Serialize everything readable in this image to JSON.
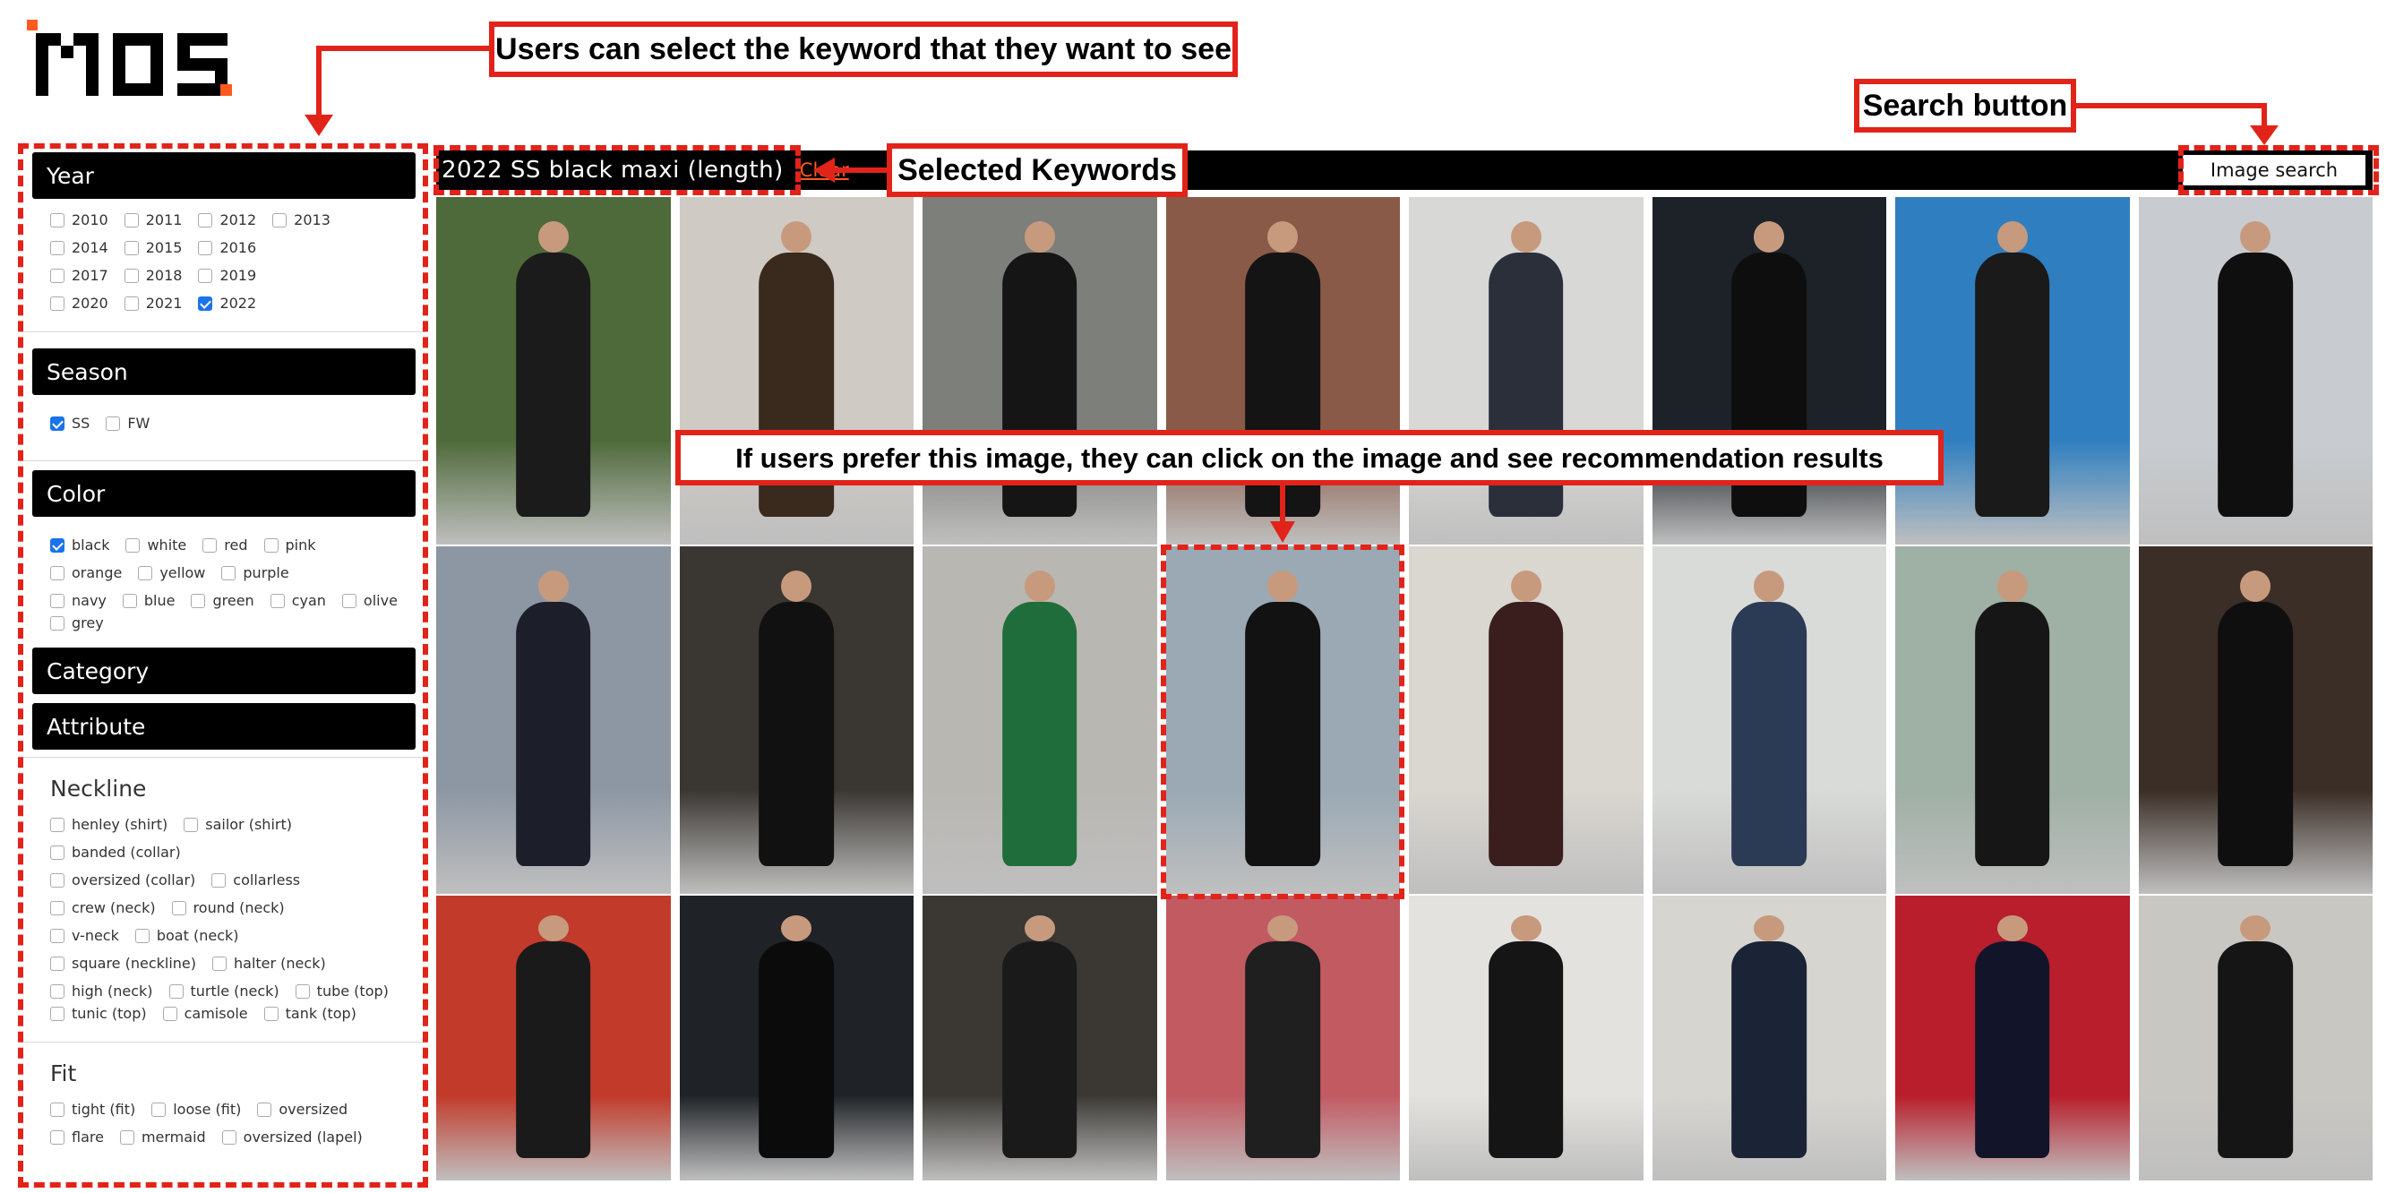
{
  "logo": {
    "text": "MOS",
    "accent": "#ff5a1f"
  },
  "annotations": {
    "keyword": "Users can select the keyword that they want to see",
    "search": "Search button",
    "selected": "Selected Keywords",
    "prefer": "If users prefer this image, they can click on the image and see recommendation results"
  },
  "topbar": {
    "keywords": "2022  SS  black  maxi (length)",
    "clear": "Clear",
    "image_search": "Image search"
  },
  "sidebar": {
    "year": {
      "title": "Year",
      "options": [
        {
          "label": "2010",
          "checked": false
        },
        {
          "label": "2011",
          "checked": false
        },
        {
          "label": "2012",
          "checked": false
        },
        {
          "label": "2013",
          "checked": false
        },
        {
          "label": "2014",
          "checked": false
        },
        {
          "label": "2015",
          "checked": false
        },
        {
          "label": "2016",
          "checked": false
        },
        {
          "label": "2017",
          "checked": false
        },
        {
          "label": "2018",
          "checked": false
        },
        {
          "label": "2019",
          "checked": false
        },
        {
          "label": "2020",
          "checked": false
        },
        {
          "label": "2021",
          "checked": false
        },
        {
          "label": "2022",
          "checked": true
        }
      ]
    },
    "season": {
      "title": "Season",
      "options": [
        {
          "label": "SS",
          "checked": true
        },
        {
          "label": "FW",
          "checked": false
        }
      ]
    },
    "color": {
      "title": "Color",
      "options": [
        {
          "label": "black",
          "checked": true
        },
        {
          "label": "white",
          "checked": false
        },
        {
          "label": "red",
          "checked": false
        },
        {
          "label": "pink",
          "checked": false
        },
        {
          "label": "orange",
          "checked": false
        },
        {
          "label": "yellow",
          "checked": false
        },
        {
          "label": "purple",
          "checked": false
        },
        {
          "label": "navy",
          "checked": false
        },
        {
          "label": "blue",
          "checked": false
        },
        {
          "label": "green",
          "checked": false
        },
        {
          "label": "cyan",
          "checked": false
        },
        {
          "label": "olive",
          "checked": false
        },
        {
          "label": "grey",
          "checked": false
        }
      ]
    },
    "category": {
      "title": "Category"
    },
    "attribute": {
      "title": "Attribute"
    },
    "neckline": {
      "title": "Neckline",
      "options": [
        {
          "label": "henley (shirt)",
          "checked": false
        },
        {
          "label": "sailor (shirt)",
          "checked": false
        },
        {
          "label": "banded (collar)",
          "checked": false
        },
        {
          "label": "oversized (collar)",
          "checked": false
        },
        {
          "label": "collarless",
          "checked": false
        },
        {
          "label": "crew (neck)",
          "checked": false
        },
        {
          "label": "round (neck)",
          "checked": false
        },
        {
          "label": "v-neck",
          "checked": false
        },
        {
          "label": "boat (neck)",
          "checked": false
        },
        {
          "label": "square (neckline)",
          "checked": false
        },
        {
          "label": "halter (neck)",
          "checked": false
        },
        {
          "label": "high (neck)",
          "checked": false
        },
        {
          "label": "turtle (neck)",
          "checked": false
        },
        {
          "label": "tube (top)",
          "checked": false
        },
        {
          "label": "tunic (top)",
          "checked": false
        },
        {
          "label": "camisole",
          "checked": false
        },
        {
          "label": "tank (top)",
          "checked": false
        }
      ]
    },
    "fit": {
      "title": "Fit",
      "options": [
        {
          "label": "tight (fit)",
          "checked": false
        },
        {
          "label": "loose (fit)",
          "checked": false
        },
        {
          "label": "oversized",
          "checked": false
        },
        {
          "label": "flare",
          "checked": false
        },
        {
          "label": "mermaid",
          "checked": false
        },
        {
          "label": "oversized (lapel)",
          "checked": false
        }
      ]
    }
  },
  "photos": [
    {
      "bg": "#4f6a3a",
      "fig": "#1b1b1b"
    },
    {
      "bg": "#cfcac3",
      "fig": "#3a2a1e"
    },
    {
      "bg": "#7d7f7a",
      "fig": "#151515"
    },
    {
      "bg": "#8a5a48",
      "fig": "#141414"
    },
    {
      "bg": "#d8d8d6",
      "fig": "#2a2f3a"
    },
    {
      "bg": "#1c2228",
      "fig": "#0e0e0e"
    },
    {
      "bg": "#2f7fc0",
      "fig": "#1a1a1a"
    },
    {
      "bg": "#c8ccd0",
      "fig": "#0f0f0f"
    },
    {
      "bg": "#8d97a3",
      "fig": "#1c1f2a"
    },
    {
      "bg": "#3a3632",
      "fig": "#111111"
    },
    {
      "bg": "#b9b7b2",
      "fig": "#1f6d3a"
    },
    {
      "bg": "#9aa9b4",
      "fig": "#121212"
    },
    {
      "bg": "#dad6d0",
      "fig": "#3a1e1e"
    },
    {
      "bg": "#d9dbd8",
      "fig": "#2b3a55"
    },
    {
      "bg": "#9fb0a5",
      "fig": "#161616"
    },
    {
      "bg": "#3a2e26",
      "fig": "#0f0f0f"
    },
    {
      "bg": "#c23a2a",
      "fig": "#1a1a1a"
    },
    {
      "bg": "#1f2226",
      "fig": "#0b0b0b"
    },
    {
      "bg": "#3b3834",
      "fig": "#1a1a1a"
    },
    {
      "bg": "#c25a62",
      "fig": "#1f1f1f"
    },
    {
      "bg": "#e3e2de",
      "fig": "#151515"
    },
    {
      "bg": "#d6d5d0",
      "fig": "#1b2436"
    },
    {
      "bg": "#b81e2b",
      "fig": "#12152a"
    },
    {
      "bg": "#c9c7c2",
      "fig": "#151515"
    }
  ]
}
